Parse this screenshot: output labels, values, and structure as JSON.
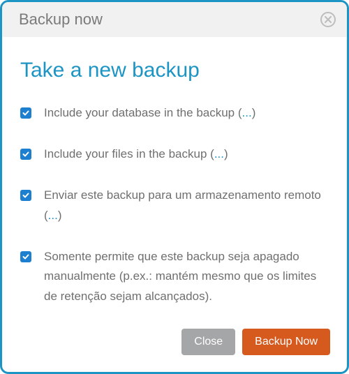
{
  "header": {
    "title": "Backup now"
  },
  "body": {
    "title": "Take a new backup"
  },
  "options": [
    {
      "checked": true,
      "label_pre": "Include your database in the backup ",
      "paren_open": "(",
      "dots": "...",
      "paren_close": ")"
    },
    {
      "checked": true,
      "label_pre": "Include your files in the backup ",
      "paren_open": "(",
      "dots": "...",
      "paren_close": ")"
    },
    {
      "checked": true,
      "label_pre": "Enviar este backup para um armazenamento remoto ",
      "paren_open": "(",
      "dots": "...",
      "paren_close": ")"
    },
    {
      "checked": true,
      "label_full": "Somente permite que este backup seja apagado manualmente (p.ex.: mantém mesmo que os limites de retenção sejam alcançados)."
    }
  ],
  "footer": {
    "close_label": "Close",
    "primary_label": "Backup Now"
  }
}
